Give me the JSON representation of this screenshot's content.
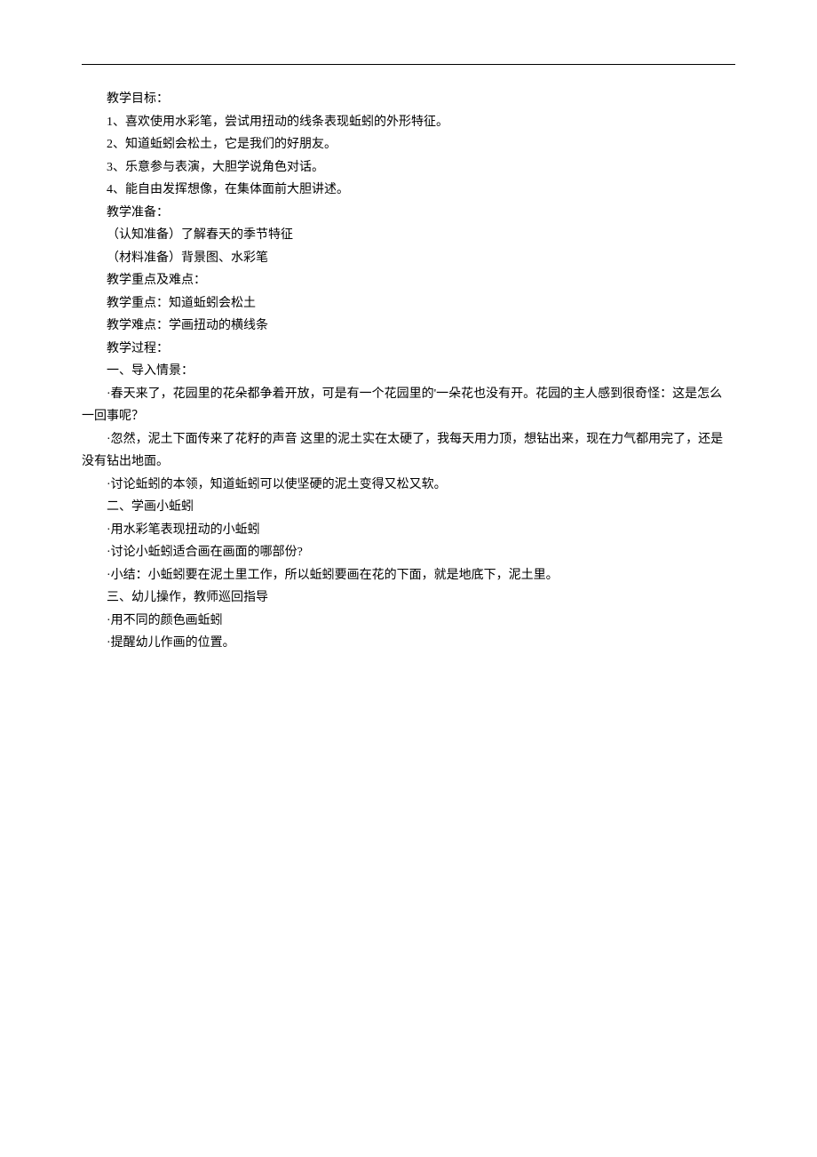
{
  "sections": {
    "goals_header": "教学目标：",
    "goal1": "1、喜欢使用水彩笔，尝试用扭动的线条表现蚯蚓的外形特征。",
    "goal2": "2、知道蚯蚓会松土，它是我们的好朋友。",
    "goal3": "3、乐意参与表演，大胆学说角色对话。",
    "goal4": "4、能自由发挥想像，在集体面前大胆讲述。",
    "prep_header": "教学准备：",
    "prep1": "（认知准备）了解春天的季节特征",
    "prep2": "（材料准备）背景图、水彩笔",
    "focus_header": "教学重点及难点：",
    "focus1": "教学重点：知道蚯蚓会松土",
    "focus2": "教学难点：学画扭动的横线条",
    "process_header": "教学过程：",
    "section1_header": "一、导入情景：",
    "s1_line1": "·春天来了，花园里的花朵都争着开放，可是有一个花园里的'一朵花也没有开。花园的主人感到很奇怪：这是怎么",
    "s1_line1b": "一回事呢？",
    "s1_line2": "·忽然，泥土下面传来了花籽的声音 这里的泥土实在太硬了，我每天用力顶，想钻出来，现在力气都用完了，还是",
    "s1_line2b": "没有钻出地面。",
    "s1_line3": "·讨论蚯蚓的本领，知道蚯蚓可以使坚硬的泥土变得又松又软。",
    "section2_header": "二、学画小蚯蚓",
    "s2_line1": "·用水彩笔表现扭动的小蚯蚓",
    "s2_line2": "·讨论小蚯蚓适合画在画面的哪部份?",
    "s2_line3": "·小结：小蚯蚓要在泥土里工作，所以蚯蚓要画在花的下面，就是地底下，泥土里。",
    "section3_header": "三、幼儿操作，教师巡回指导",
    "s3_line1": "·用不同的颜色画蚯蚓",
    "s3_line2": "·提醒幼儿作画的位置。"
  }
}
